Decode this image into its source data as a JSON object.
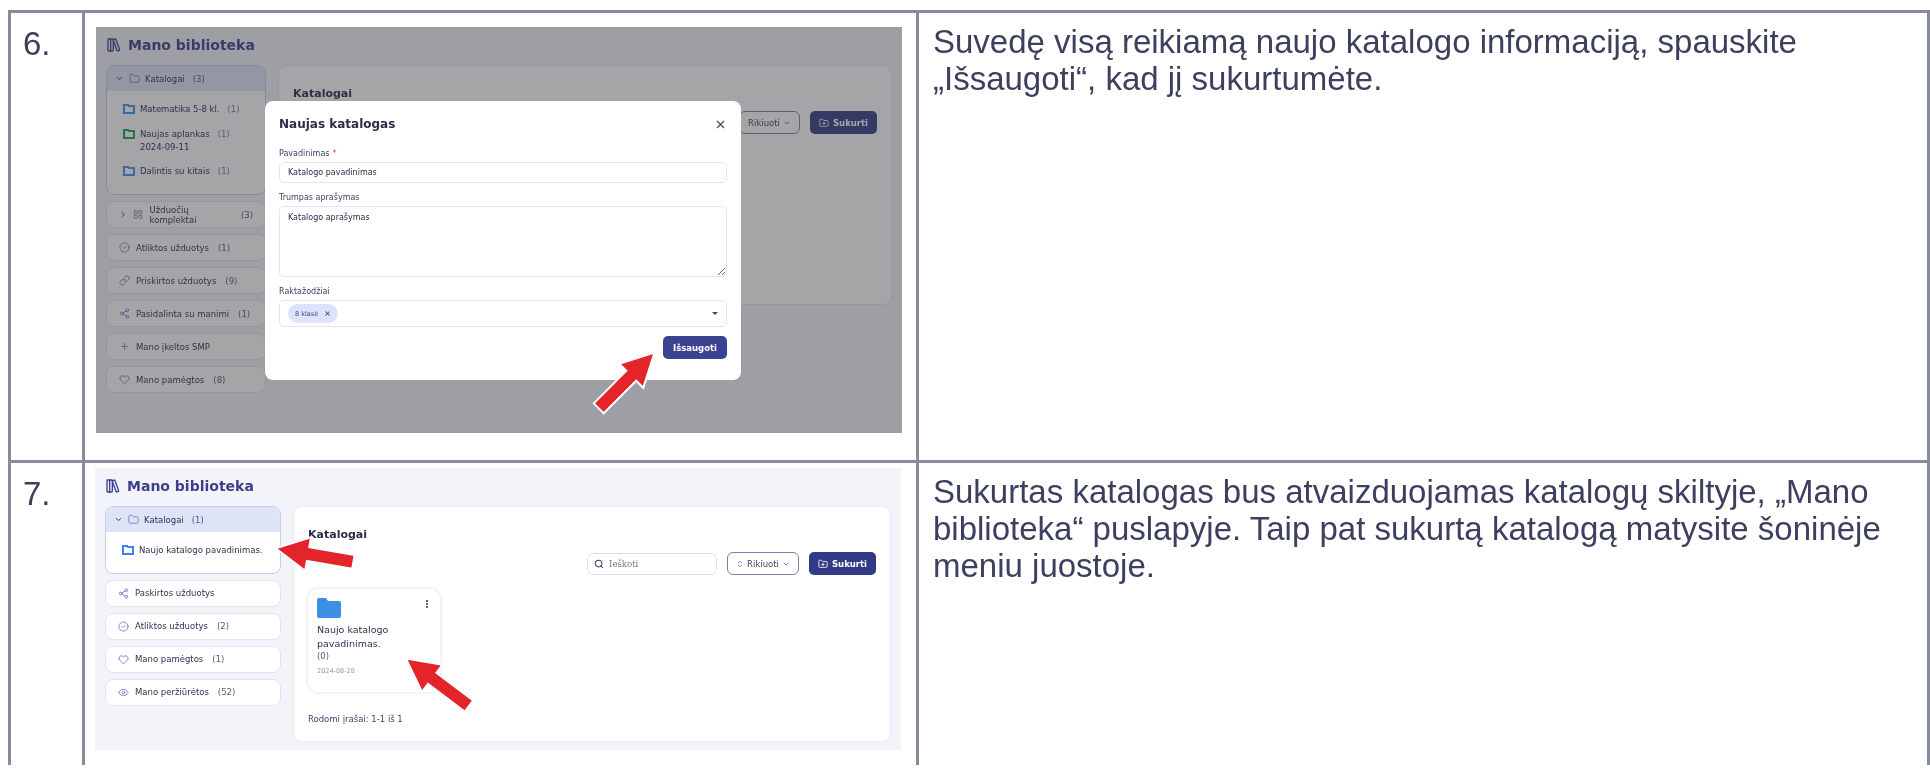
{
  "table": {
    "rows": [
      {
        "number": "6.",
        "screenshot": {
          "title": "Mano biblioteka",
          "sidebar": [
            {
              "kind": "folder",
              "label": "Katalogai",
              "count": "(3)",
              "expanded": true,
              "children": [
                {
                  "label": "Matematika 5-8 kl.",
                  "count": "(1)",
                  "color": "#396aa2"
                },
                {
                  "label": "Naujas aplankas\n2024-09-11",
                  "count": "(1)",
                  "color": "#2b724c"
                },
                {
                  "label": "Dalintis su kitais",
                  "count": "(1)",
                  "color": "#396aa2"
                }
              ]
            },
            {
              "kind": "sets",
              "label": "Užduočių komplektai",
              "count": "(3)",
              "expanded": false
            },
            {
              "kind": "done",
              "label": "Atliktos užduotys",
              "count": "(1)"
            },
            {
              "kind": "link",
              "label": "Priskirtos užduotys",
              "count": "(9)"
            },
            {
              "kind": "share",
              "label": "Pasidalinta su manimi",
              "count": "(1)"
            },
            {
              "kind": "plus",
              "label": "Mano įkeltos SMP"
            },
            {
              "kind": "heart",
              "label": "Mano pamėgtos",
              "count": "(8)"
            }
          ],
          "panel": {
            "heading": "Katalogai",
            "sort_button": "Rikiuoti",
            "create_button": "Sukurti"
          },
          "modal": {
            "title": "Naujas katalogas",
            "fields": [
              {
                "kind": "input",
                "label": "Pavadinimas",
                "marker": "*",
                "value": "Katalogo pavadinimas"
              },
              {
                "kind": "textarea",
                "label": "Trumpas aprašymas",
                "value": "Katalogo aprašymas"
              },
              {
                "kind": "tags",
                "label": "Raktažodžiai",
                "tags": [
                  "8 klasė"
                ]
              }
            ],
            "submit": {
              "label": "Išsaugoti",
              "highlighted": true
            }
          }
        },
        "description": "Suvedę visą reikiamą naujo katalogo informaciją, spauskite „Išsaugoti“, kad jį sukurtumėte."
      },
      {
        "number": "7.",
        "screenshot": {
          "title": "Mano biblioteka",
          "sidebar": [
            {
              "kind": "folder",
              "label": "Katalogai",
              "count": "(1)",
              "expanded": true,
              "children": [
                {
                  "label": "Naujo katalogo pavadinimas.",
                  "color": "#3b82f6",
                  "highlighted": true
                }
              ]
            },
            {
              "kind": "share",
              "label": "Paskirtos užduotys"
            },
            {
              "kind": "done",
              "label": "Atliktos užduotys",
              "count": "(2)"
            },
            {
              "kind": "heart",
              "label": "Mano pamėgtos",
              "count": "(1)"
            },
            {
              "kind": "eye",
              "label": "Mano peržiūrėtos",
              "count": "(52)"
            }
          ],
          "panel": {
            "heading": "Katalogai",
            "search": {
              "placeholder": "Ieškoti"
            },
            "sort_button": "Rikiuoti",
            "create_button": "Sukurti",
            "cards": [
              {
                "title": "Naujo katalogo pavadinimas.",
                "count": "(0)",
                "date": "2024-08-28",
                "highlighted": true
              }
            ],
            "footer": "Rodomi įrašai: 1-1 iš 1"
          }
        },
        "description": "Sukurtas katalogas bus atvaizduojamas katalogų skiltyje, „Mano biblioteka“ puslapyje. Taip pat sukurtą katalogą matysite šoninėje meniu juostoje."
      }
    ]
  }
}
